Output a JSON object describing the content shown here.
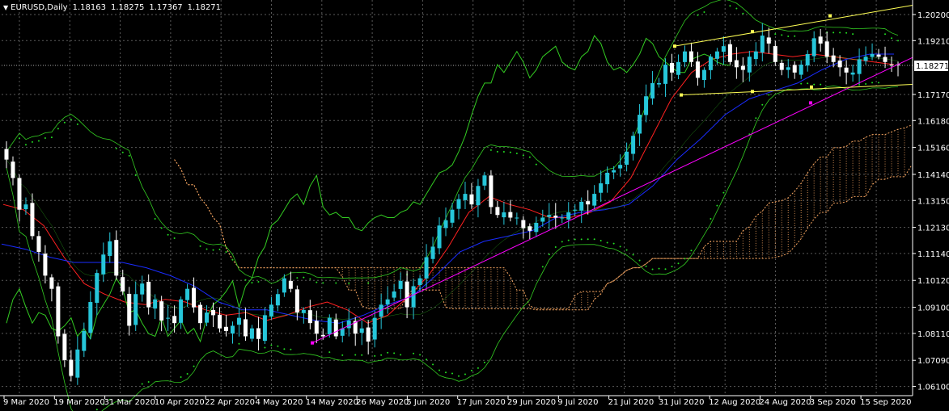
{
  "header": {
    "symbol": "EURUSD,Daily",
    "open": "1.18163",
    "high": "1.18275",
    "low": "1.17367",
    "close": "1.18271"
  },
  "current_price_label": "1.18271",
  "colors": {
    "background": "#000000",
    "grid": "#5a5a5a",
    "bull_candle": "#26c6da",
    "bear_candle": "#ffffff",
    "tenkan": "#ff2020",
    "kijun": "#1a2cff",
    "chikou": "#33cc22",
    "bollinger": "#33cc22",
    "kumo": "#f4a460",
    "trendline_lower": "#ff00ff",
    "channel": "#ffff55",
    "parabolic_sar": "#22dd22"
  },
  "chart_data": {
    "type": "candlestick",
    "symbol": "EURUSD",
    "timeframe": "Daily",
    "y_ticks": [
      "1.20200",
      "1.19210",
      "1.18271",
      "1.17170",
      "1.16180",
      "1.15160",
      "1.14140",
      "1.13150",
      "1.12130",
      "1.11140",
      "1.10120",
      "1.09100",
      "1.08110",
      "1.07090",
      "1.06100"
    ],
    "ylim": [
      1.058,
      1.207
    ],
    "x_ticks": [
      "9 Mar 2020",
      "19 Mar 2020",
      "31 Mar 2020",
      "10 Apr 2020",
      "22 Apr 2020",
      "4 May 2020",
      "14 May 2020",
      "26 May 2020",
      "5 Jun 2020",
      "17 Jun 2020",
      "29 Jun 2020",
      "9 Jul 2020",
      "21 Jul 2020",
      "31 Jul 2020",
      "12 Aug 2020",
      "24 Aug 2020",
      "3 Sep 2020",
      "15 Sep 2020"
    ],
    "closes": [
      1.147,
      1.14,
      1.128,
      1.13,
      1.118,
      1.112,
      1.103,
      1.098,
      1.08,
      1.071,
      1.065,
      1.075,
      1.082,
      1.093,
      1.104,
      1.111,
      1.116,
      1.103,
      1.097,
      1.084,
      1.096,
      1.1,
      1.091,
      1.094,
      1.086,
      1.087,
      1.085,
      1.094,
      1.098,
      1.091,
      1.085,
      1.089,
      1.088,
      1.083,
      1.082,
      1.084,
      1.087,
      1.08,
      1.083,
      1.079,
      1.088,
      1.092,
      1.096,
      1.102,
      1.098,
      1.089,
      1.09,
      1.085,
      1.081,
      1.08,
      1.087,
      1.08,
      1.083,
      1.086,
      1.081,
      1.083,
      1.078,
      1.087,
      1.092,
      1.094,
      1.097,
      1.101,
      1.091,
      1.099,
      1.102,
      1.11,
      1.114,
      1.122,
      1.124,
      1.128,
      1.132,
      1.134,
      1.13,
      1.137,
      1.141,
      1.129,
      1.126,
      1.127,
      1.125,
      1.125,
      1.121,
      1.12,
      1.123,
      1.125,
      1.126,
      1.125,
      1.125,
      1.127,
      1.128,
      1.131,
      1.13,
      1.134,
      1.138,
      1.142,
      1.143,
      1.145,
      1.15,
      1.156,
      1.164,
      1.171,
      1.176,
      1.176,
      1.183,
      1.18,
      1.184,
      1.188,
      1.184,
      1.178,
      1.181,
      1.186,
      1.188,
      1.19,
      1.184,
      1.182,
      1.181,
      1.186,
      1.188,
      1.194,
      1.191,
      1.184,
      1.181,
      1.182,
      1.18,
      1.183,
      1.187,
      1.193,
      1.191,
      1.186,
      1.184,
      1.182,
      1.18,
      1.18,
      1.185,
      1.186,
      1.187,
      1.186,
      1.184,
      1.183,
      1.18271
    ],
    "tenkan_sen": [
      1.13,
      1.128,
      1.122,
      1.11,
      1.1,
      1.096,
      1.093,
      1.092,
      1.094,
      1.093,
      1.09,
      1.088,
      1.089,
      1.086,
      1.088,
      1.091,
      1.093,
      1.09,
      1.085,
      1.088,
      1.095,
      1.103,
      1.114,
      1.127,
      1.133,
      1.13,
      1.128,
      1.125,
      1.125,
      1.127,
      1.131,
      1.14,
      1.155,
      1.17,
      1.18,
      1.185,
      1.187,
      1.188,
      1.187,
      1.186,
      1.187,
      1.186,
      1.185,
      1.184,
      1.183
    ],
    "kijun_sen": [
      1.115,
      1.113,
      1.11,
      1.108,
      1.108,
      1.108,
      1.106,
      1.103,
      1.099,
      1.093,
      1.09,
      1.09,
      1.088,
      1.086,
      1.085,
      1.088,
      1.092,
      1.095,
      1.103,
      1.112,
      1.116,
      1.118,
      1.12,
      1.125,
      1.127,
      1.128,
      1.13,
      1.137,
      1.147,
      1.155,
      1.164,
      1.17,
      1.173,
      1.176,
      1.181,
      1.185,
      1.187,
      1.187
    ],
    "support_trendline": [
      [
        1.0775,
        1.1857
      ]
    ],
    "resistance_channel_upper": [
      1.19,
      1.2055
    ],
    "resistance_channel_lower": [
      1.1715,
      1.1755
    ],
    "indicators": [
      "Ichimoku Kinko Hyo",
      "Bollinger Bands",
      "Parabolic SAR"
    ],
    "grid": true
  }
}
